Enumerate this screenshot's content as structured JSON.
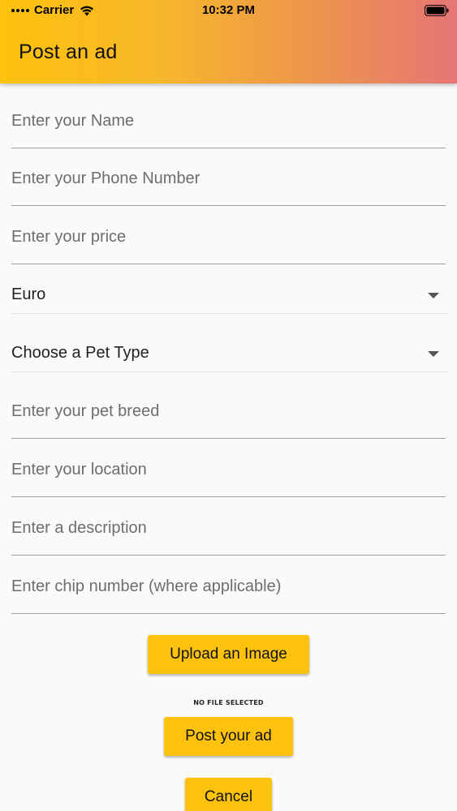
{
  "status_bar": {
    "carrier": "Carrier",
    "time": "10:32 PM"
  },
  "app_bar": {
    "title": "Post an ad"
  },
  "form": {
    "name_placeholder": "Enter your Name",
    "phone_placeholder": "Enter your Phone Number",
    "price_placeholder": "Enter your price",
    "currency_value": "Euro",
    "pet_type_placeholder": "Choose a Pet Type",
    "breed_placeholder": "Enter your pet breed",
    "location_placeholder": "Enter your location",
    "description_placeholder": "Enter a description",
    "chip_placeholder": "Enter chip number (where applicable)"
  },
  "actions": {
    "upload_label": "Upload an Image",
    "file_status": "NO FILE SELECTED",
    "post_label": "Post your ad",
    "cancel_label": "Cancel"
  },
  "colors": {
    "accent": "#fdc20d",
    "gradient_end": "#e67575"
  },
  "icons": {
    "wifi": "wifi-icon",
    "battery": "battery-icon",
    "dropdown": "chevron-down-icon"
  }
}
